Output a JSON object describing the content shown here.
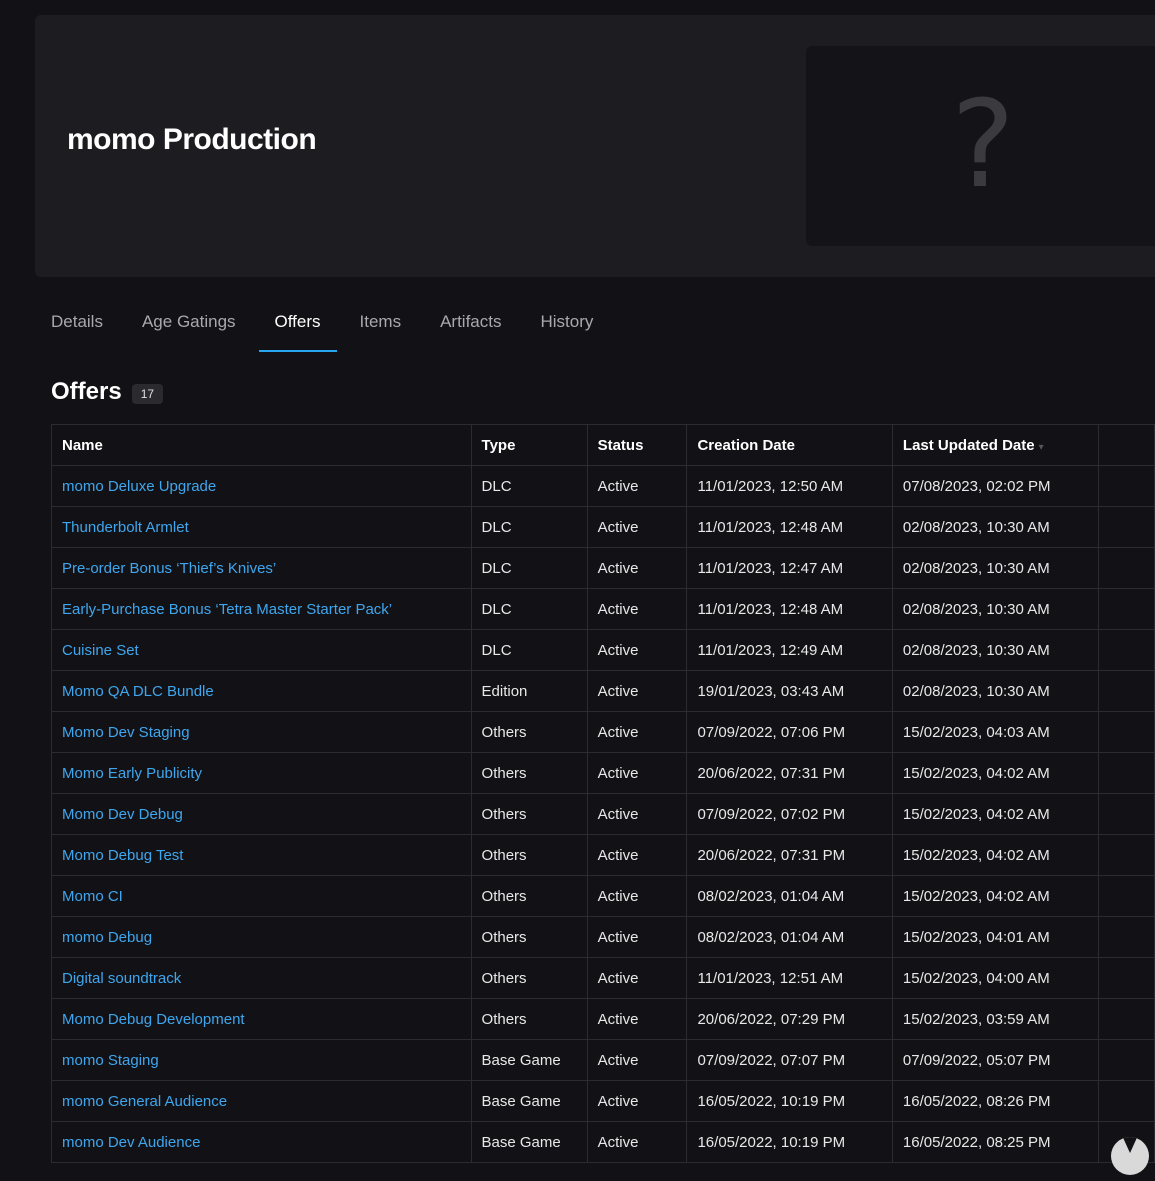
{
  "product": {
    "title": "momo Production",
    "image_placeholder": "?"
  },
  "tabs": [
    {
      "label": "Details"
    },
    {
      "label": "Age Gatings"
    },
    {
      "label": "Offers"
    },
    {
      "label": "Items"
    },
    {
      "label": "Artifacts"
    },
    {
      "label": "History"
    }
  ],
  "active_tab": "Offers",
  "offers": {
    "title": "Offers",
    "count": "17",
    "columns": [
      "Name",
      "Type",
      "Status",
      "Creation Date",
      "Last Updated Date"
    ],
    "sort_indicator": "▾",
    "rows": [
      {
        "name": "momo Deluxe Upgrade",
        "type": "DLC",
        "status": "Active",
        "created": "11/01/2023, 12:50 AM",
        "updated": "07/08/2023, 02:02 PM"
      },
      {
        "name": "Thunderbolt Armlet",
        "type": "DLC",
        "status": "Active",
        "created": "11/01/2023, 12:48 AM",
        "updated": "02/08/2023, 10:30 AM"
      },
      {
        "name": "Pre-order Bonus ‘Thief’s Knives’",
        "type": "DLC",
        "status": "Active",
        "created": "11/01/2023, 12:47 AM",
        "updated": "02/08/2023, 10:30 AM"
      },
      {
        "name": "Early-Purchase Bonus ‘Tetra Master Starter Pack’",
        "type": "DLC",
        "status": "Active",
        "created": "11/01/2023, 12:48 AM",
        "updated": "02/08/2023, 10:30 AM"
      },
      {
        "name": "Cuisine Set",
        "type": "DLC",
        "status": "Active",
        "created": "11/01/2023, 12:49 AM",
        "updated": "02/08/2023, 10:30 AM"
      },
      {
        "name": "Momo QA DLC Bundle",
        "type": "Edition",
        "status": "Active",
        "created": "19/01/2023, 03:43 AM",
        "updated": "02/08/2023, 10:30 AM"
      },
      {
        "name": "Momo Dev Staging",
        "type": "Others",
        "status": "Active",
        "created": "07/09/2022, 07:06 PM",
        "updated": "15/02/2023, 04:03 AM"
      },
      {
        "name": "Momo Early Publicity",
        "type": "Others",
        "status": "Active",
        "created": "20/06/2022, 07:31 PM",
        "updated": "15/02/2023, 04:02 AM"
      },
      {
        "name": "Momo Dev Debug",
        "type": "Others",
        "status": "Active",
        "created": "07/09/2022, 07:02 PM",
        "updated": "15/02/2023, 04:02 AM"
      },
      {
        "name": "Momo Debug Test",
        "type": "Others",
        "status": "Active",
        "created": "20/06/2022, 07:31 PM",
        "updated": "15/02/2023, 04:02 AM"
      },
      {
        "name": "Momo CI",
        "type": "Others",
        "status": "Active",
        "created": "08/02/2023, 01:04 AM",
        "updated": "15/02/2023, 04:02 AM"
      },
      {
        "name": "momo Debug",
        "type": "Others",
        "status": "Active",
        "created": "08/02/2023, 01:04 AM",
        "updated": "15/02/2023, 04:01 AM"
      },
      {
        "name": "Digital soundtrack",
        "type": "Others",
        "status": "Active",
        "created": "11/01/2023, 12:51 AM",
        "updated": "15/02/2023, 04:00 AM"
      },
      {
        "name": "Momo Debug Development",
        "type": "Others",
        "status": "Active",
        "created": "20/06/2022, 07:29 PM",
        "updated": "15/02/2023, 03:59 AM"
      },
      {
        "name": "momo Staging",
        "type": "Base Game",
        "status": "Active",
        "created": "07/09/2022, 07:07 PM",
        "updated": "07/09/2022, 05:07 PM"
      },
      {
        "name": "momo General Audience",
        "type": "Base Game",
        "status": "Active",
        "created": "16/05/2022, 10:19 PM",
        "updated": "16/05/2022, 08:26 PM"
      },
      {
        "name": "momo Dev Audience",
        "type": "Base Game",
        "status": "Active",
        "created": "16/05/2022, 10:19 PM",
        "updated": "16/05/2022, 08:25 PM"
      }
    ]
  },
  "colors": {
    "accent": "#26a5f0",
    "link": "#3fa6ee",
    "background": "#121216",
    "panel": "#1d1d21"
  }
}
